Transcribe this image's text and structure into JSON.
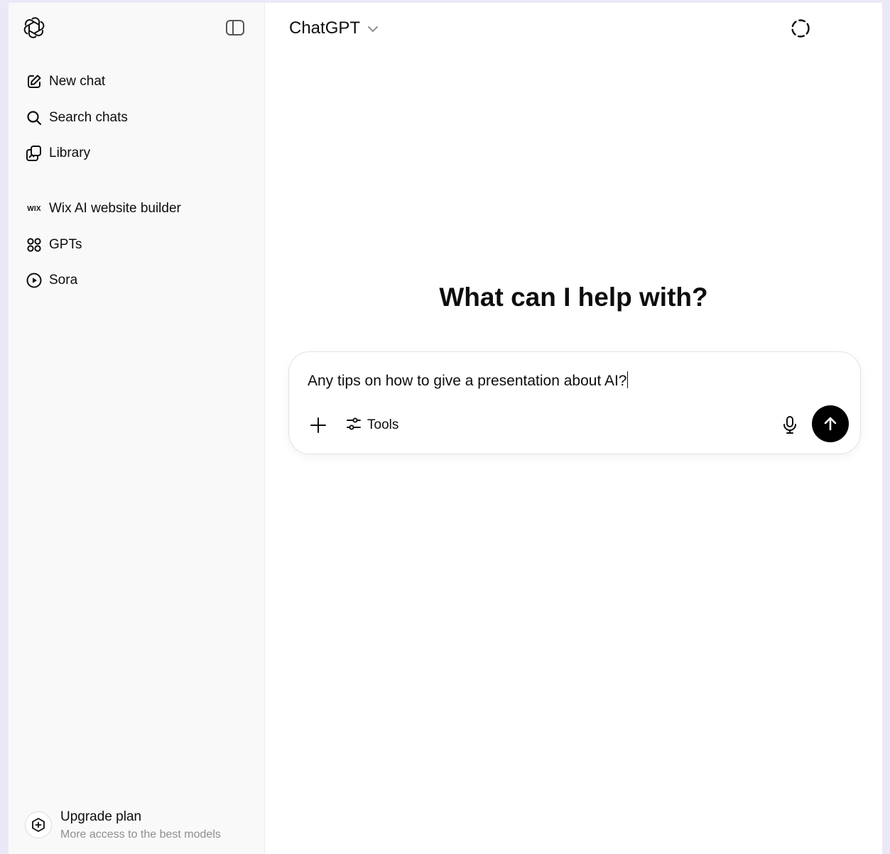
{
  "sidebar": {
    "logo_icon": "openai-logo-icon",
    "toggle_icon": "sidebar-toggle-icon",
    "primary_items": [
      {
        "label": "New chat",
        "icon": "edit-icon"
      },
      {
        "label": "Search chats",
        "icon": "search-icon"
      },
      {
        "label": "Library",
        "icon": "library-icon"
      }
    ],
    "secondary_items": [
      {
        "label": "Wix AI website builder",
        "icon": "wix-icon",
        "icon_text": "WIX"
      },
      {
        "label": "GPTs",
        "icon": "gpts-grid-icon"
      },
      {
        "label": "Sora",
        "icon": "play-icon"
      }
    ],
    "upgrade": {
      "title": "Upgrade plan",
      "subtitle": "More access to the best models",
      "icon": "upgrade-icon"
    }
  },
  "header": {
    "model_name": "ChatGPT",
    "temporary_chat_icon": "temporary-chat-icon",
    "avatar_icon": "user-avatar"
  },
  "main": {
    "headline": "What can I help with?",
    "composer": {
      "input_value": "Any tips on how to give a presentation about AI?",
      "tools_label": "Tools"
    }
  },
  "colors": {
    "page_background": "#ebe8f7",
    "sidebar_background": "#f9f9f9",
    "send_button": "#000000",
    "text": "#0d0d0d",
    "muted_text": "#8e8e8e"
  }
}
